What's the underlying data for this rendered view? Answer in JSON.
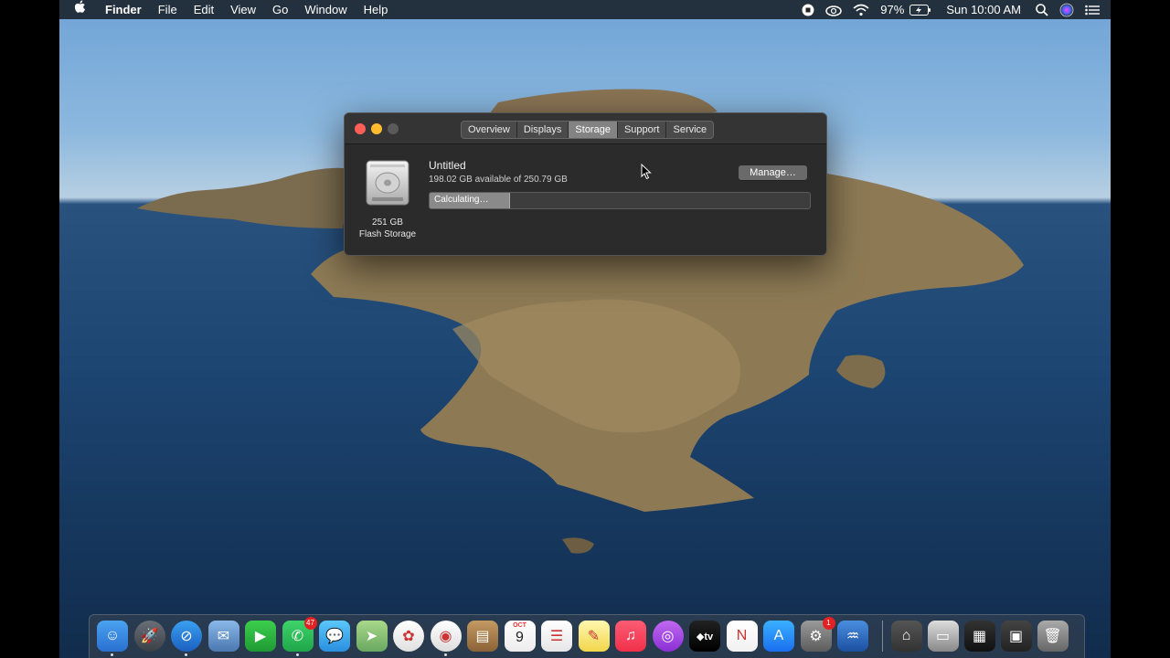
{
  "menubar": {
    "app": "Finder",
    "items": [
      "File",
      "Edit",
      "View",
      "Go",
      "Window",
      "Help"
    ],
    "battery": "97%",
    "clock": "Sun 10:00 AM"
  },
  "window": {
    "tabs": [
      {
        "label": "Overview"
      },
      {
        "label": "Displays"
      },
      {
        "label": "Storage",
        "active": true
      },
      {
        "label": "Support"
      },
      {
        "label": "Service"
      }
    ],
    "disk_size": "251 GB",
    "disk_type": "Flash Storage",
    "volume_name": "Untitled",
    "availability": "198.02 GB available of 250.79 GB",
    "bar_label": "Calculating…",
    "bar_fill_fraction": 0.21,
    "manage_label": "Manage…"
  },
  "dock": {
    "apps": [
      {
        "name": "finder",
        "running": true
      },
      {
        "name": "launchpad"
      },
      {
        "name": "safari",
        "running": true
      },
      {
        "name": "mail-bird"
      },
      {
        "name": "facetime"
      },
      {
        "name": "whatsapp",
        "badge": "47",
        "running": true
      },
      {
        "name": "messages"
      },
      {
        "name": "maps"
      },
      {
        "name": "photos"
      },
      {
        "name": "chrome",
        "running": true
      },
      {
        "name": "contacts"
      },
      {
        "name": "calendar",
        "month": "OCT",
        "day": "9"
      },
      {
        "name": "reminders"
      },
      {
        "name": "notes"
      },
      {
        "name": "music"
      },
      {
        "name": "podcasts"
      },
      {
        "name": "apple-tv",
        "label": "tv"
      },
      {
        "name": "news"
      },
      {
        "name": "app-store"
      },
      {
        "name": "system-preferences",
        "badge": "1"
      },
      {
        "name": "audio-app"
      }
    ]
  },
  "colors": {
    "close": "#ff5f57",
    "minimize": "#febc2e",
    "zoom_inactive": "#5a5a5a",
    "badge": "#e22222"
  }
}
